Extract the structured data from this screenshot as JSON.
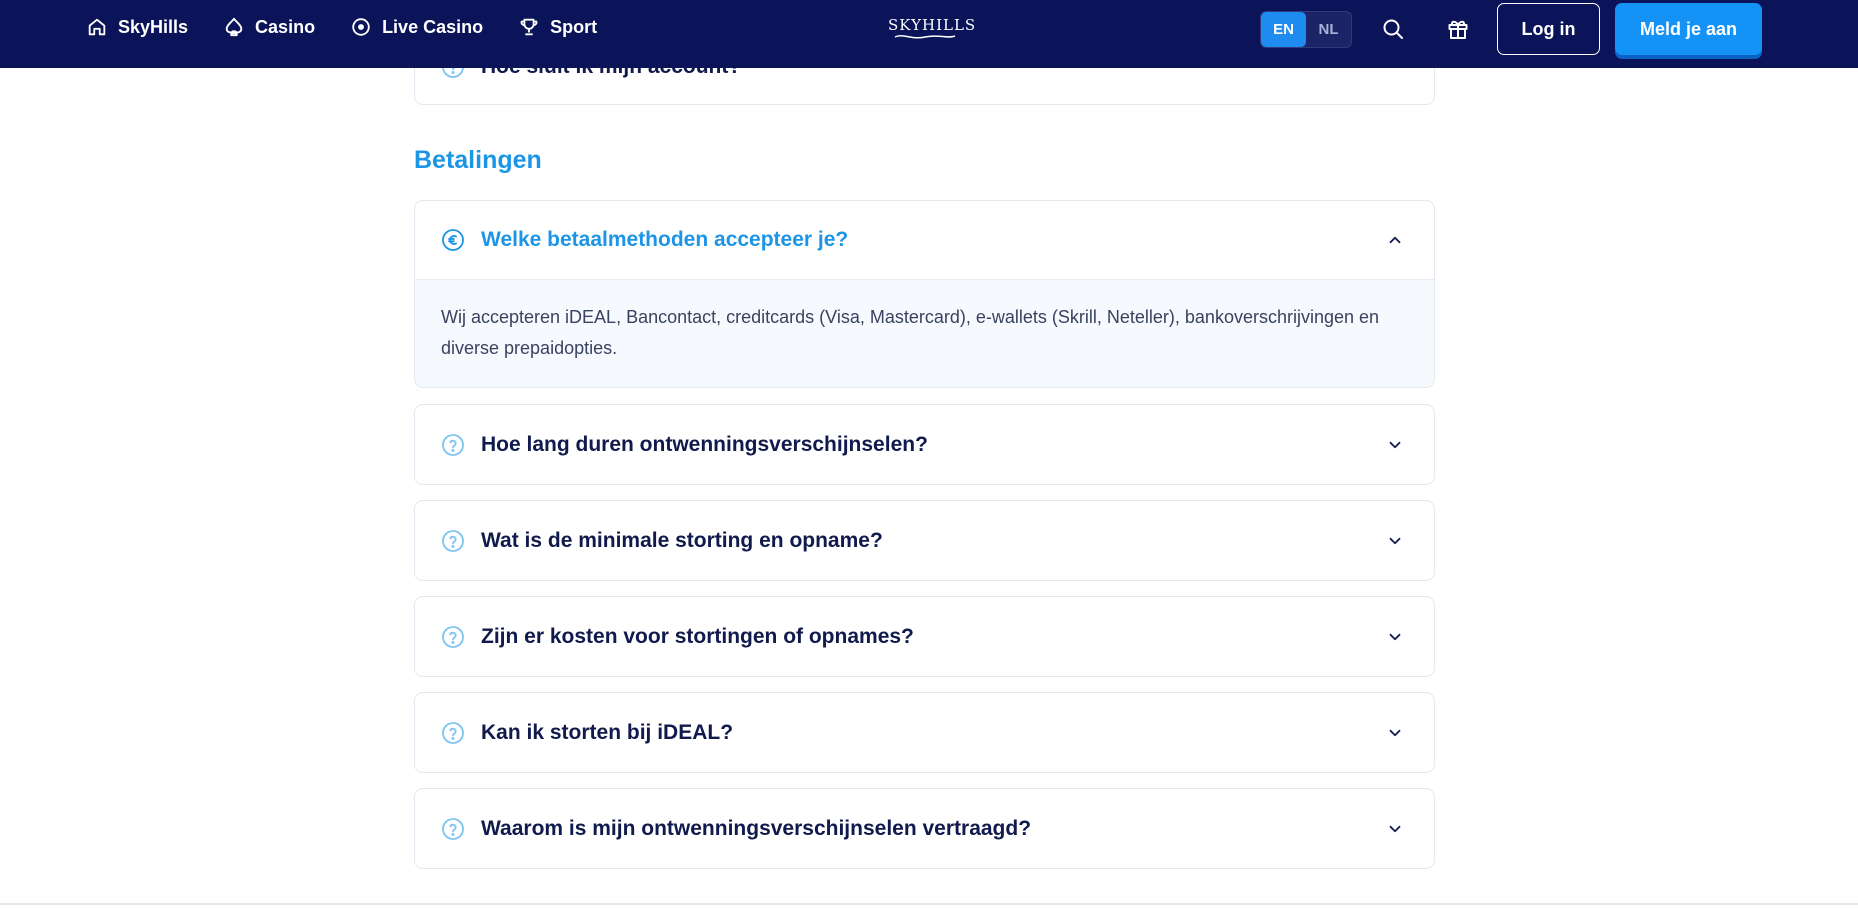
{
  "header": {
    "nav": [
      {
        "label": "SkyHills",
        "icon": "home-icon"
      },
      {
        "label": "Casino",
        "icon": "spade-icon"
      },
      {
        "label": "Live Casino",
        "icon": "chip-icon"
      },
      {
        "label": "Sport",
        "icon": "trophy-icon"
      }
    ],
    "logo_text": "SKYHILLS",
    "lang": {
      "en": "EN",
      "nl": "NL",
      "active": "EN"
    },
    "login_label": "Log in",
    "signup_label": "Meld je aan"
  },
  "prev_section": {
    "last_question": "Hoe sluit ik mijn account?"
  },
  "section": {
    "title": "Betalingen",
    "items": [
      {
        "question": "Welke betaalmethoden accepteer je?",
        "open": true,
        "answer": "Wij accepteren iDEAL, Bancontact, creditcards (Visa, Mastercard), e-wallets (Skrill, Neteller), bankoverschrijvingen en diverse prepaidopties."
      },
      {
        "question": "Hoe lang duren ontwenningsverschijnselen?",
        "open": false
      },
      {
        "question": "Wat is de minimale storting en opname?",
        "open": false
      },
      {
        "question": "Zijn er kosten voor stortingen of opnames?",
        "open": false
      },
      {
        "question": "Kan ik storten bij iDEAL?",
        "open": false
      },
      {
        "question": "Waarom is mijn ontwenningsverschijnselen vertraagd?",
        "open": false
      }
    ]
  },
  "colors": {
    "header_bg": "#0b1459",
    "accent": "#1d95e6",
    "button_blue": "#1592f5",
    "question_text": "#101a4d"
  }
}
